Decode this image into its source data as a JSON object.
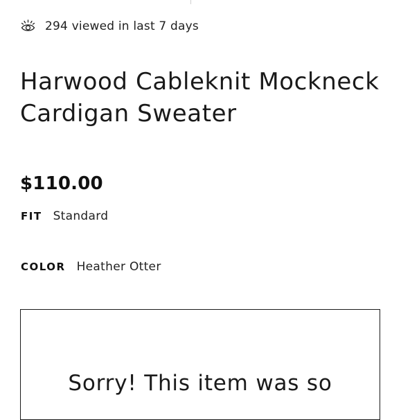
{
  "views": {
    "icon": "eye-icon",
    "text": "294 viewed in last 7 days"
  },
  "product": {
    "title": "Harwood Cableknit Mockneck Cardigan Sweater",
    "price": "$110.00",
    "fit": {
      "label": "FIT",
      "value": "Standard"
    },
    "color": {
      "label": "COLOR",
      "value": "Heather Otter"
    }
  },
  "availability": {
    "message": "Sorry! This item was so"
  }
}
